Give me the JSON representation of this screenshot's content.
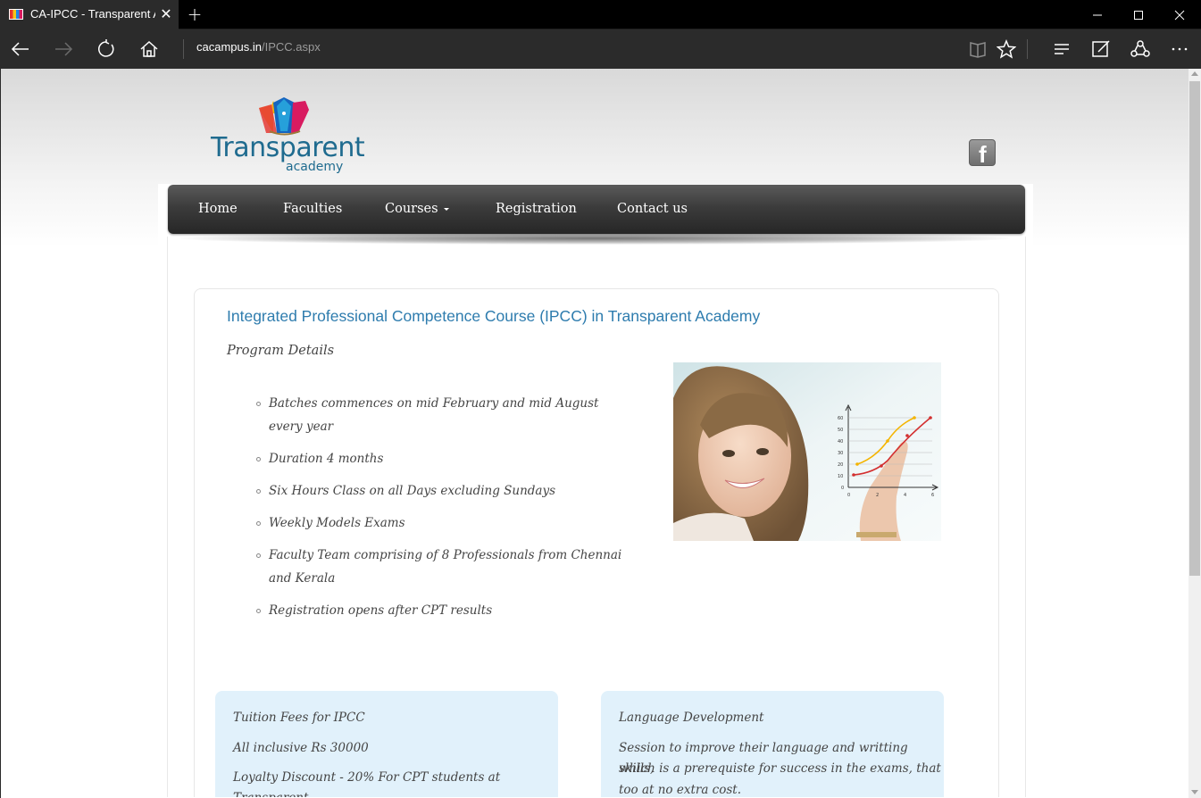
{
  "browser": {
    "tab_title": "CA-IPCC - Transparent A",
    "url_host": "cacampus.in",
    "url_path": "/IPCC.aspx",
    "theme_color": "#2b2b2b"
  },
  "site": {
    "logo_word": "Transparent",
    "logo_sub": "academy",
    "facebook_glyph": "f",
    "menu": {
      "home": "Home",
      "faculties": "Faculties",
      "courses": "Courses",
      "registration": "Registration",
      "contact": "Contact us"
    }
  },
  "main": {
    "heading": "Integrated Professional Competence Course (IPCC) in Transparent Academy",
    "subheading": "Program Details",
    "bullets": [
      "Batches commences on mid February and mid August every year",
      "Duration 4 months",
      "Six Hours Class on all Days excluding Sundays",
      "Weekly Models Exams",
      "Faculty Team comprising of 8 Professionals from Chennai and Kerala",
      "Registration opens after CPT results"
    ],
    "heading_color": "#2e7cae"
  },
  "cards": {
    "fees": {
      "title": "Tuition Fees for IPCC",
      "line1": "All inclusive Rs 30000",
      "line2": "Loyalty Discount - 20% For CPT students at",
      "line3": "Transparent"
    },
    "language": {
      "title": "Language Development",
      "line1": "Session to improve their language and writting skills,",
      "line2": "which is a prerequiste for success in the exams, that",
      "line3": "too at no extra cost."
    },
    "background": "#e1f1fb"
  },
  "chart_in_photo": {
    "y_ticks": [
      "60",
      "50",
      "40",
      "30",
      "20",
      "10",
      "0"
    ],
    "x_ticks": [
      "0",
      "2",
      "4",
      "6"
    ]
  }
}
